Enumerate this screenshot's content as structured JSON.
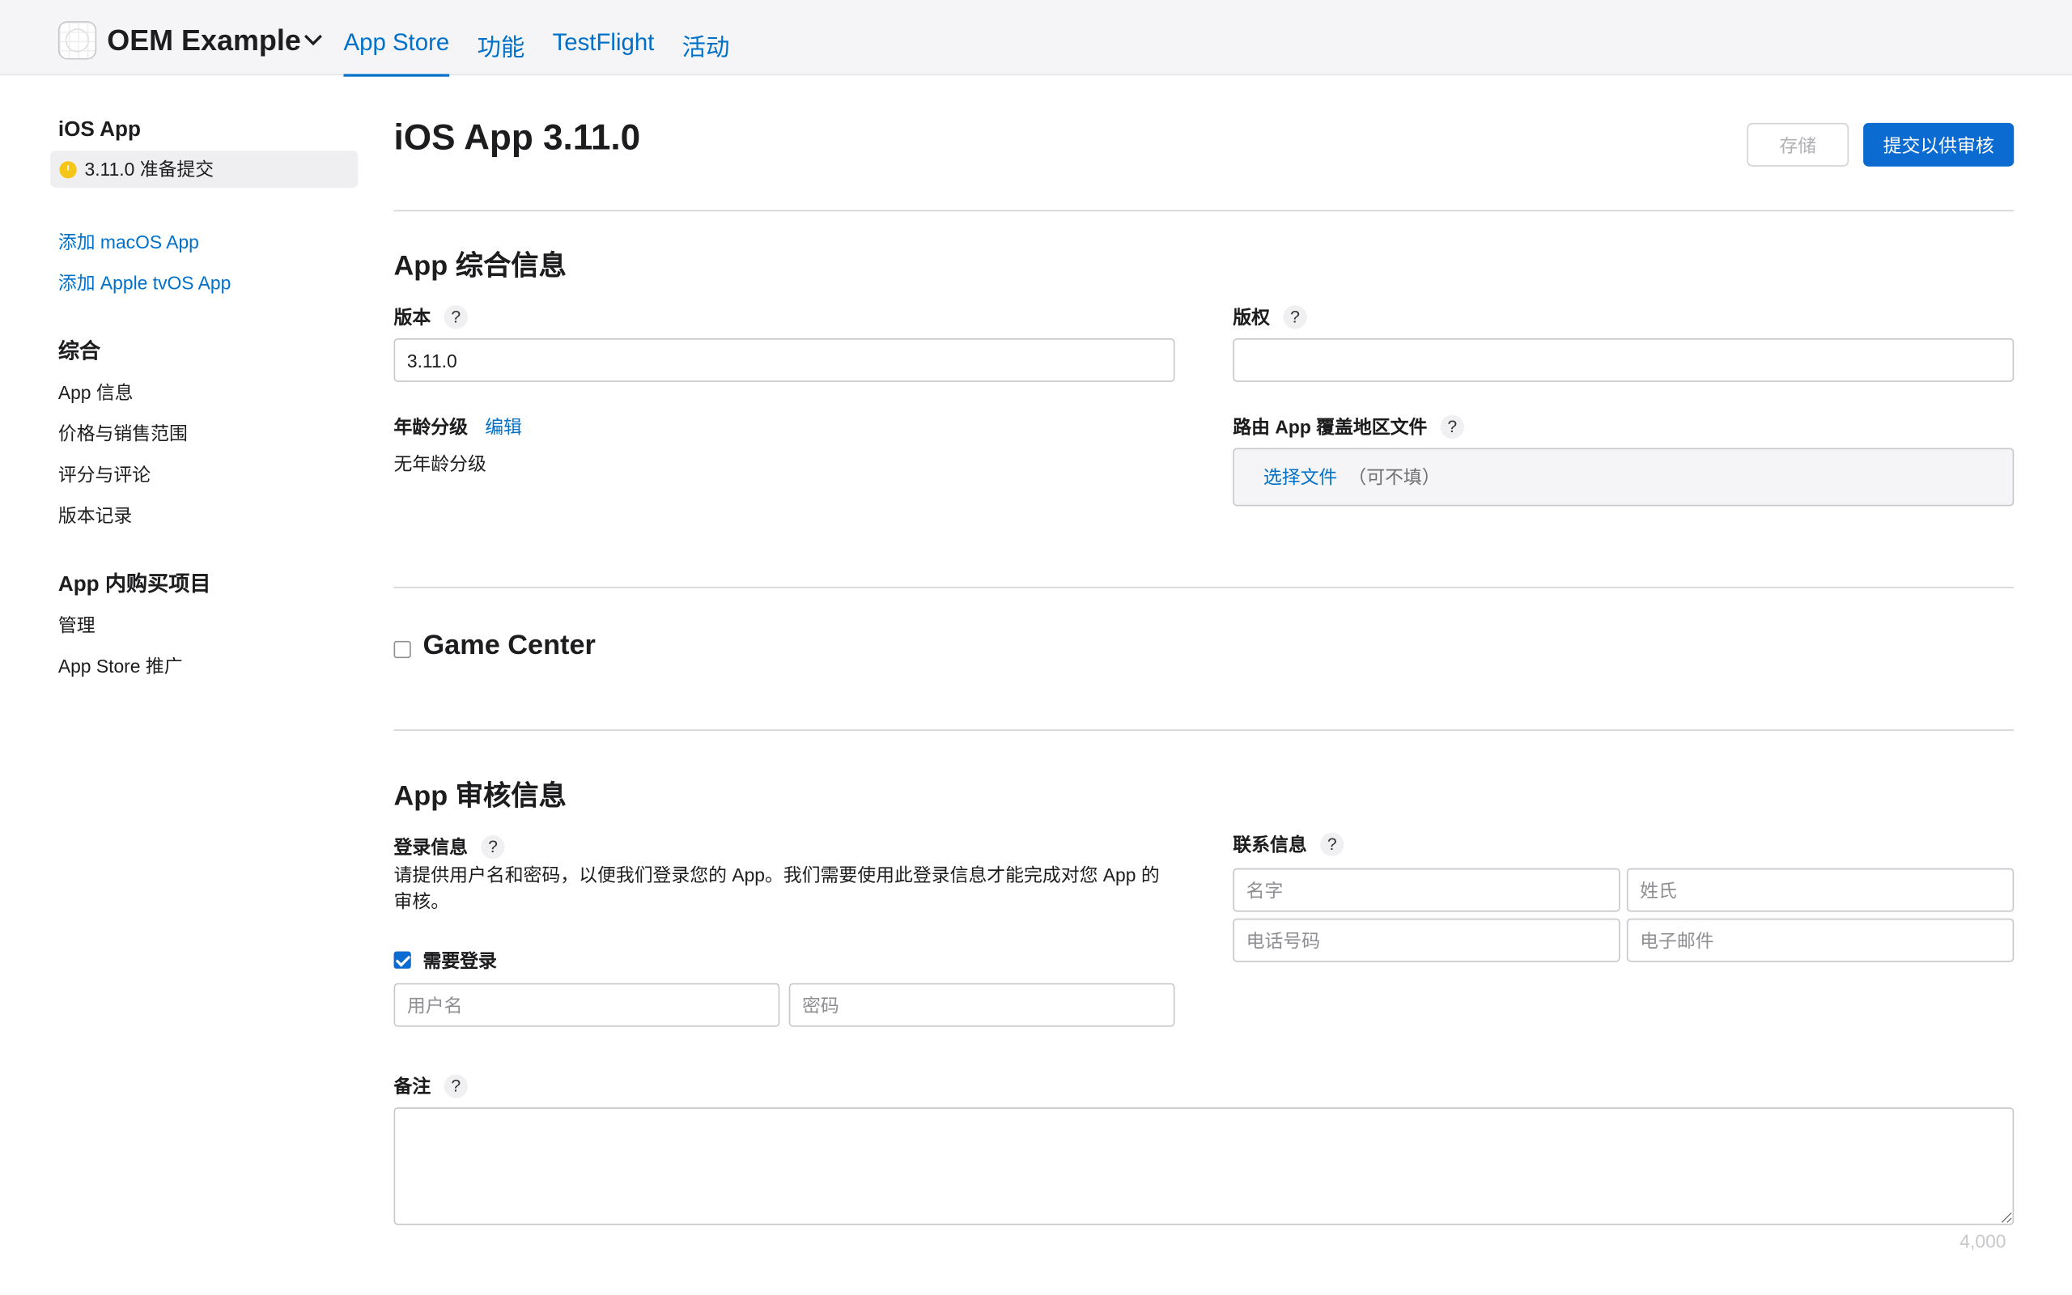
{
  "header": {
    "app_name": "OEM Example",
    "tabs": [
      {
        "label": "App Store",
        "active": true
      },
      {
        "label": "功能",
        "active": false
      },
      {
        "label": "TestFlight",
        "active": false
      },
      {
        "label": "活动",
        "active": false
      }
    ]
  },
  "sidebar": {
    "platform_title": "iOS App",
    "version_item": "3.11.0 准备提交",
    "add_links": [
      "添加 macOS App",
      "添加 Apple tvOS App"
    ],
    "general_title": "综合",
    "general_items": [
      "App 信息",
      "价格与销售范围",
      "评分与评论",
      "版本记录"
    ],
    "iap_title": "App 内购买项目",
    "iap_items": [
      "管理",
      "App Store 推广"
    ]
  },
  "main": {
    "title": "iOS App 3.11.0",
    "save_label": "存储",
    "submit_label": "提交以供审核",
    "general_section": {
      "title": "App 综合信息",
      "version_label": "版本",
      "version_value": "3.11.0",
      "copyright_label": "版权",
      "copyright_value": "",
      "age_rating_label": "年龄分级",
      "age_rating_edit": "编辑",
      "age_rating_value": "无年龄分级",
      "routing_label": "路由 App 覆盖地区文件",
      "choose_file": "选择文件",
      "optional": "（可不填）"
    },
    "game_center": {
      "label": "Game Center",
      "checked": false
    },
    "review_section": {
      "title": "App 审核信息",
      "login_label": "登录信息",
      "login_desc": "请提供用户名和密码，以便我们登录您的 App。我们需要使用此登录信息才能完成对您 App 的审核。",
      "login_required_label": "需要登录",
      "login_required": true,
      "username_placeholder": "用户名",
      "password_placeholder": "密码",
      "contact_label": "联系信息",
      "first_name_placeholder": "名字",
      "last_name_placeholder": "姓氏",
      "phone_placeholder": "电话号码",
      "email_placeholder": "电子邮件",
      "notes_label": "备注",
      "notes_counter": "4,000"
    },
    "help_glyph": "?"
  }
}
